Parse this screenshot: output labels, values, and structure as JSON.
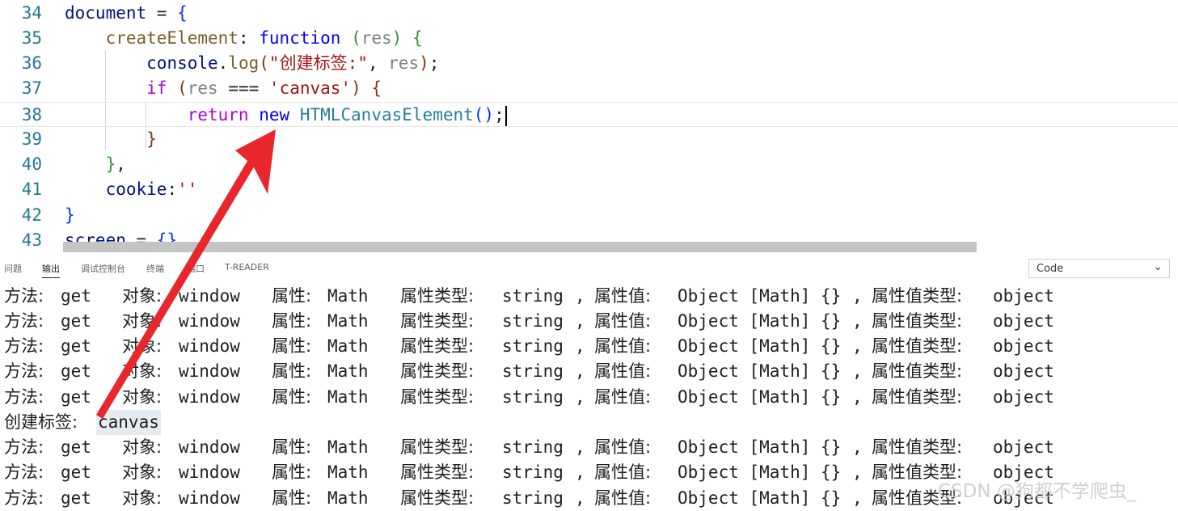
{
  "editor": {
    "lines": [
      {
        "num": "34",
        "current": false,
        "tokens": [
          [
            "var",
            "document"
          ],
          [
            "plain",
            " = "
          ],
          [
            "brk1",
            "{"
          ]
        ]
      },
      {
        "num": "35",
        "current": false,
        "tokens": [
          [
            "plain",
            "    "
          ],
          [
            "fn",
            "createElement"
          ],
          [
            "plain",
            ": "
          ],
          [
            "kw-blue",
            "function"
          ],
          [
            "plain",
            " "
          ],
          [
            "brk2",
            "("
          ],
          [
            "param",
            "res"
          ],
          [
            "brk2",
            ")"
          ],
          [
            "plain",
            " "
          ],
          [
            "brk2",
            "{"
          ]
        ]
      },
      {
        "num": "36",
        "current": false,
        "tokens": [
          [
            "plain",
            "        "
          ],
          [
            "var",
            "console"
          ],
          [
            "plain",
            "."
          ],
          [
            "fn",
            "log"
          ],
          [
            "brk3",
            "("
          ],
          [
            "str",
            "\"创建标签:\""
          ],
          [
            "plain",
            ", "
          ],
          [
            "param",
            "res"
          ],
          [
            "brk3",
            ")"
          ],
          [
            "plain",
            ";"
          ]
        ]
      },
      {
        "num": "37",
        "current": false,
        "tokens": [
          [
            "plain",
            "        "
          ],
          [
            "kw-purple",
            "if"
          ],
          [
            "plain",
            " "
          ],
          [
            "brk3",
            "("
          ],
          [
            "param",
            "res"
          ],
          [
            "plain",
            " === "
          ],
          [
            "str",
            "'canvas'"
          ],
          [
            "brk3",
            ")"
          ],
          [
            "plain",
            " "
          ],
          [
            "brk3",
            "{"
          ]
        ]
      },
      {
        "num": "38",
        "current": true,
        "tokens": [
          [
            "plain",
            "            "
          ],
          [
            "kw-purple",
            "return"
          ],
          [
            "plain",
            " "
          ],
          [
            "kw-blue",
            "new"
          ],
          [
            "plain",
            " "
          ],
          [
            "cls",
            "HTMLCanvasElement"
          ],
          [
            "brk1",
            "()"
          ],
          [
            "plain",
            ";"
          ]
        ]
      },
      {
        "num": "39",
        "current": false,
        "tokens": [
          [
            "plain",
            "        "
          ],
          [
            "brk3",
            "}"
          ]
        ]
      },
      {
        "num": "40",
        "current": false,
        "tokens": [
          [
            "plain",
            "    "
          ],
          [
            "brk2",
            "}"
          ],
          [
            "plain",
            ","
          ]
        ]
      },
      {
        "num": "41",
        "current": false,
        "tokens": [
          [
            "plain",
            "    "
          ],
          [
            "var",
            "cookie"
          ],
          [
            "plain",
            ":"
          ],
          [
            "str",
            "''"
          ]
        ]
      },
      {
        "num": "42",
        "current": false,
        "tokens": [
          [
            "brk1",
            "}"
          ]
        ]
      },
      {
        "num": "43",
        "current": false,
        "tokens": [
          [
            "var",
            "screen"
          ],
          [
            "plain",
            " = "
          ],
          [
            "brk1",
            "{}"
          ]
        ]
      }
    ]
  },
  "panel": {
    "tabs": [
      {
        "label": "问题",
        "active": false
      },
      {
        "label": "输出",
        "active": true
      },
      {
        "label": "调试控制台",
        "active": false
      },
      {
        "label": "终端",
        "active": false
      },
      {
        "label": "端口",
        "active": false
      },
      {
        "label": "T-READER",
        "active": false
      }
    ],
    "channel_select": "Code"
  },
  "output": {
    "method_label": "方法:",
    "method_value": "get",
    "object_label": "对象:",
    "object_value": "window",
    "prop_label": "属性:",
    "prop_value": "Math",
    "prop_type_label": "属性类型:",
    "prop_type_value": "string",
    "separator": ",",
    "prop_val_label": "属性值:",
    "prop_val_value": "Object [Math] {}",
    "prop_val_type_label": "属性值类型:",
    "prop_val_type_value": "object",
    "create_label": "创建标签:",
    "create_value": "canvas",
    "rows": [
      "log",
      "log",
      "log",
      "log",
      "log",
      "create",
      "log",
      "log",
      "log"
    ]
  },
  "watermark": "CSDN @狗都不学爬虫_",
  "colors": {
    "arrow": "#e8262c",
    "line_number": "#237893",
    "highlight": "#e5ebf1"
  }
}
